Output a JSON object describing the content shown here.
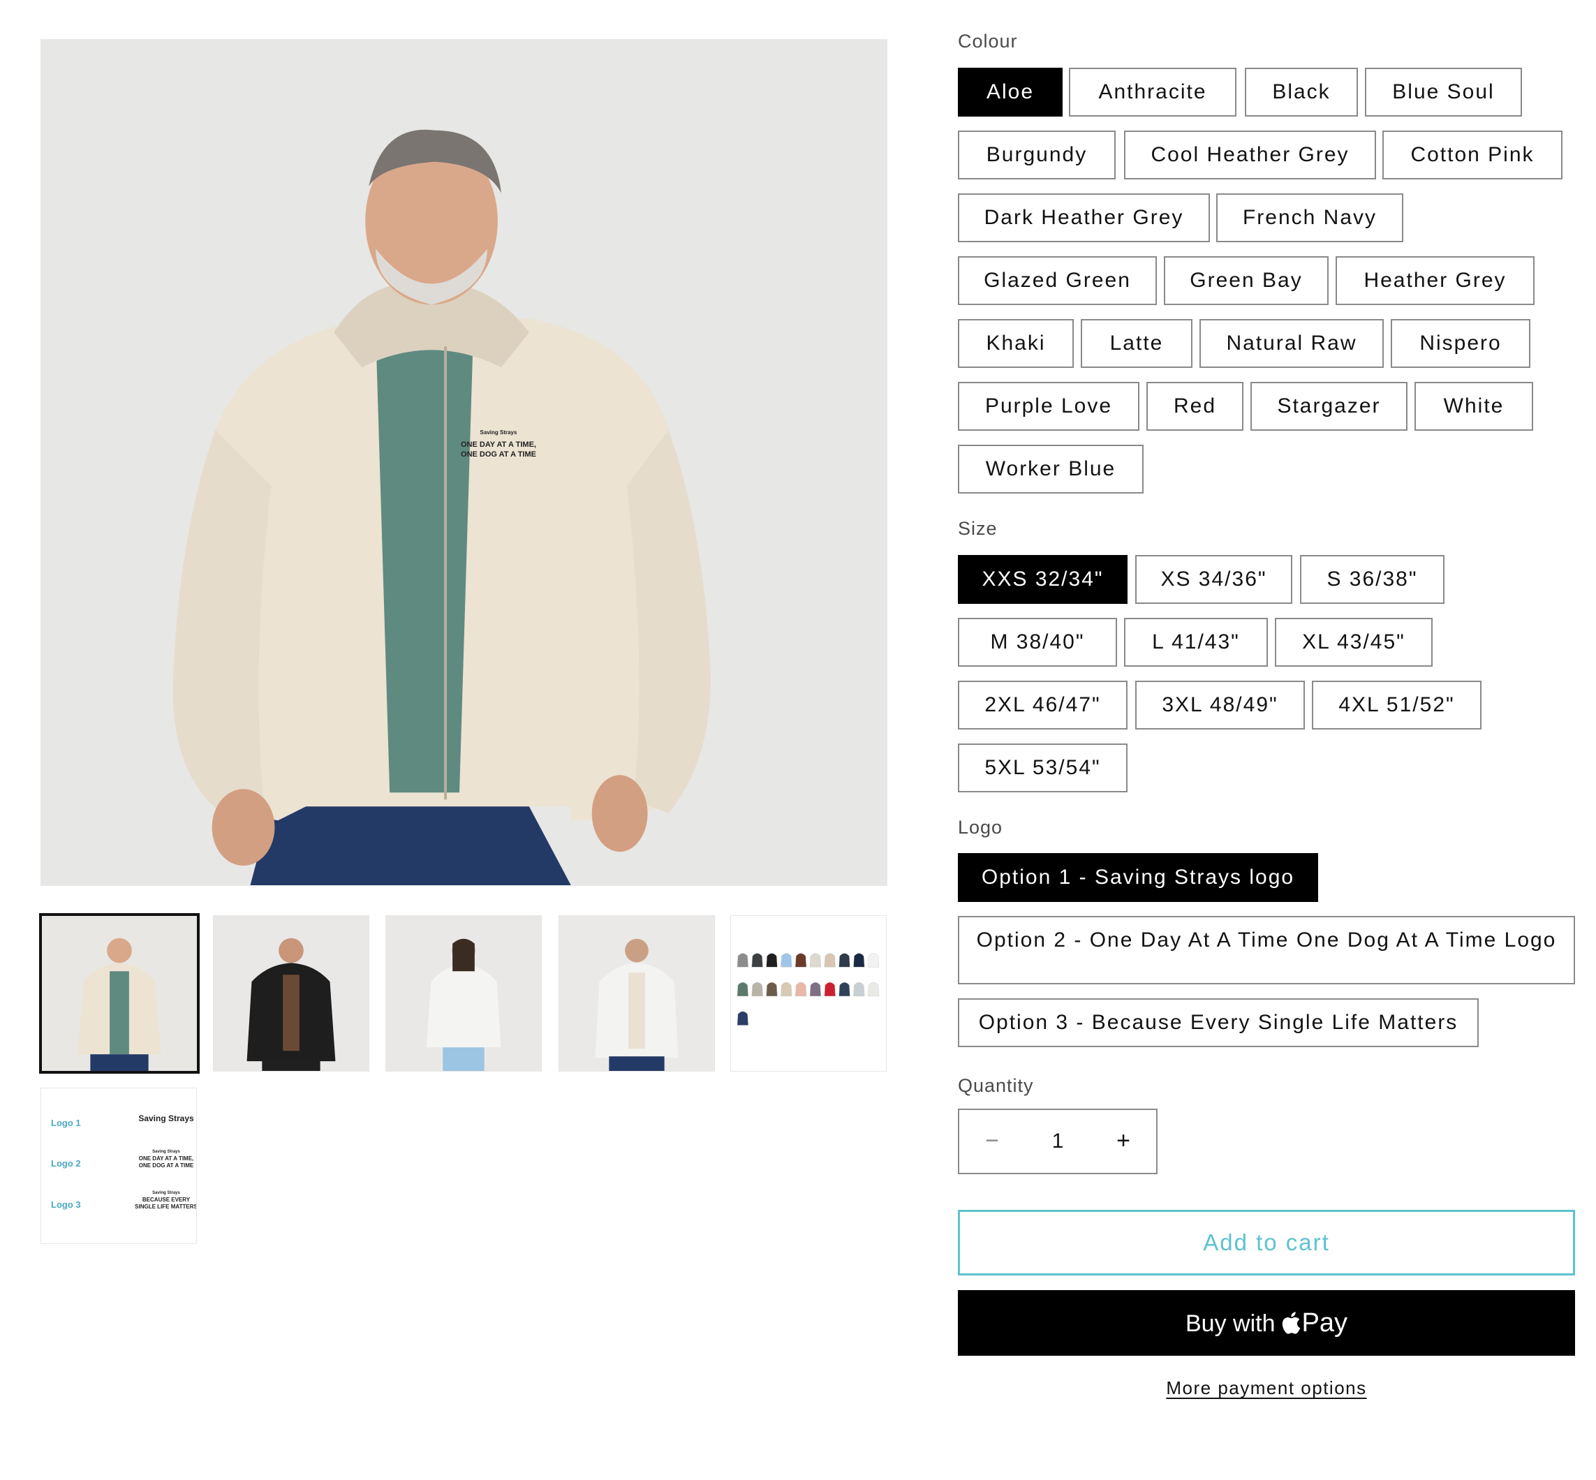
{
  "gallery": {
    "main_print": {
      "line1": "Saving Strays",
      "line2": "ONE DAY AT A TIME,",
      "line3": "ONE DOG AT A TIME"
    },
    "thumbnails": [
      {
        "name": "thumb-cream-hoodie-man"
      },
      {
        "name": "thumb-black-hoodie-man"
      },
      {
        "name": "thumb-white-hoodie-woman"
      },
      {
        "name": "thumb-white-hoodie-man"
      },
      {
        "name": "thumb-colour-swatch-chart"
      },
      {
        "name": "thumb-logo-options"
      }
    ],
    "logo_sheet": {
      "rows": [
        {
          "label": "Logo 1",
          "text": "Saving Strays"
        },
        {
          "label": "Logo 2",
          "small": "Saving Strays",
          "line1": "ONE DAY AT A TIME,",
          "line2": "ONE DOG AT A TIME"
        },
        {
          "label": "Logo 3",
          "small": "Saving Strays",
          "line1": "BECAUSE EVERY",
          "line2": "SINGLE LIFE MATTERS"
        }
      ]
    },
    "swatch_colors": [
      "#8c8c8c",
      "#3d4043",
      "#1f1f1f",
      "#9fc5e8",
      "#6b3b2a",
      "#ded9d0",
      "#d8c6b2",
      "#2f3a4a",
      "#1b2a44",
      "#f2f2f2",
      "#5b7a6b",
      "#b7b3a6",
      "#6d5a4a",
      "#d7c9b4",
      "#e7b7a8",
      "#7c6f86",
      "#cc2030",
      "#2e3f59",
      "#c8cfd4",
      "#e9e9e6",
      "#2c3e66"
    ]
  },
  "colour": {
    "label": "Colour",
    "selected": "Aloe",
    "options": [
      "Aloe",
      "Anthracite",
      "Black",
      "Blue Soul",
      "Burgundy",
      "Cool Heather Grey",
      "Cotton Pink",
      "Dark Heather Grey",
      "French Navy",
      "Glazed Green",
      "Green Bay",
      "Heather Grey",
      "Khaki",
      "Latte",
      "Natural Raw",
      "Nispero",
      "Purple Love",
      "Red",
      "Stargazer",
      "White",
      "Worker Blue"
    ]
  },
  "size": {
    "label": "Size",
    "selected": "XXS 32/34\"",
    "options": [
      "XXS 32/34\"",
      "XS 34/36\"",
      "S 36/38\"",
      "M 38/40\"",
      "L 41/43\"",
      "XL 43/45\"",
      "2XL 46/47\"",
      "3XL 48/49\"",
      "4XL 51/52\"",
      "5XL 53/54\""
    ]
  },
  "logo": {
    "label": "Logo",
    "selected": "Option 1 - Saving Strays logo",
    "options": [
      "Option 1 - Saving Strays logo",
      "Option 2 - One Day At A Time One Dog At A Time Logo",
      "Option 3 - Because Every Single Life Matters"
    ]
  },
  "quantity": {
    "label": "Quantity",
    "value": "1",
    "minus": "−",
    "plus": "+"
  },
  "buttons": {
    "add_to_cart": "Add to cart",
    "buy_with": "Buy with",
    "pay": "Pay",
    "more_payment": "More payment options"
  },
  "colors": {
    "accent": "#5ec2cf",
    "selected_bg": "#000000",
    "border": "#8a8a8a"
  }
}
